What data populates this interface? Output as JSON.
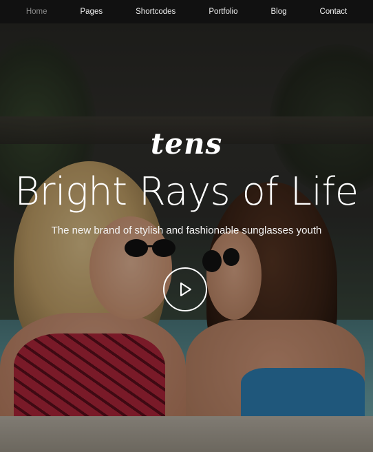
{
  "nav": {
    "items": [
      {
        "label": "Home",
        "active": true
      },
      {
        "label": "Pages",
        "active": false
      },
      {
        "label": "Shortcodes",
        "active": false
      },
      {
        "label": "Portfolio",
        "active": false
      },
      {
        "label": "Blog",
        "active": false
      },
      {
        "label": "Contact",
        "active": false
      }
    ]
  },
  "hero": {
    "logo": "tens",
    "headline": "Bright Rays of Life",
    "subtitle": "The new brand of stylish and fashionable sunglasses youth",
    "play_icon": "play-icon"
  },
  "colors": {
    "nav_bg": "#111111",
    "nav_text": "#f2f2f2",
    "nav_active": "#8a8a8a",
    "hero_text": "#ffffff"
  }
}
